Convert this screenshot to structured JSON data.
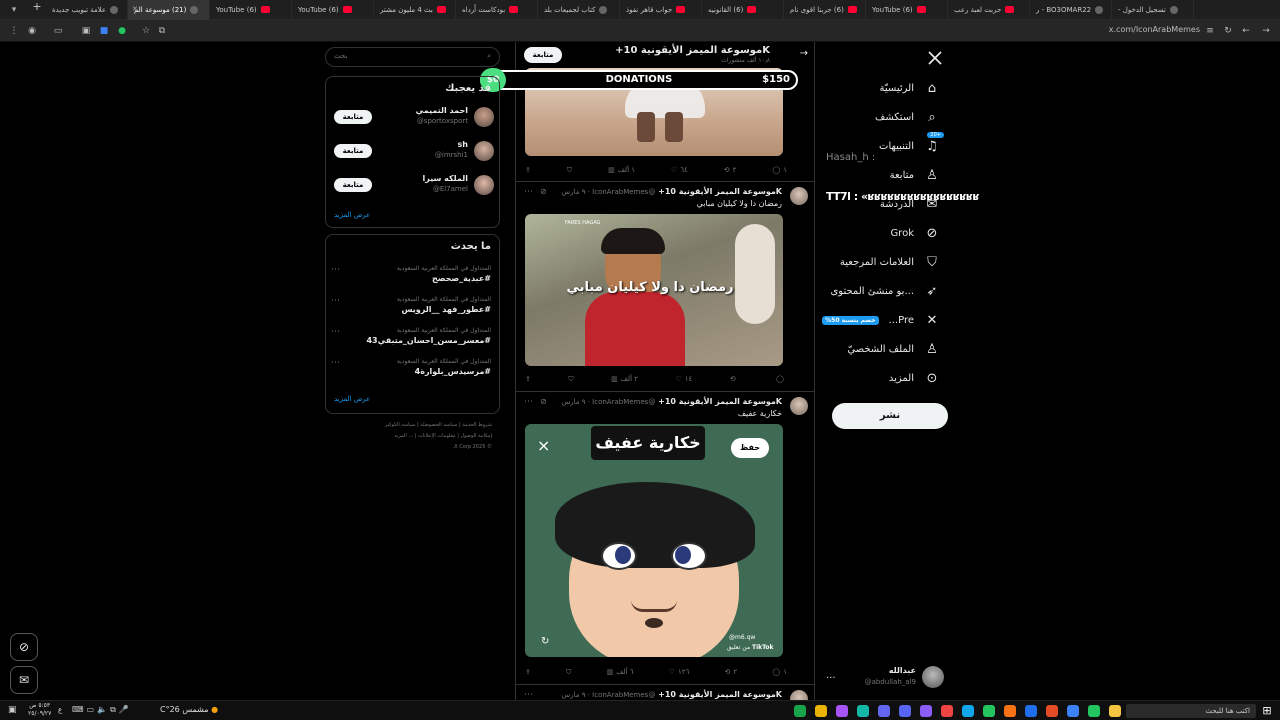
{
  "browser": {
    "tabs": [
      {
        "label": "تسجيل الدخول -",
        "kind": "dot"
      },
      {
        "label": "BO3OMAR22 - ر",
        "kind": "dot"
      },
      {
        "label": "جربت لعبة رعب",
        "kind": "yt"
      },
      {
        "label": "(6) YouTube",
        "kind": "yt"
      },
      {
        "label": "(6) جربنا اقوى نام",
        "kind": "yt"
      },
      {
        "label": "(6) القانونيه",
        "kind": "yt"
      },
      {
        "label": "جواب قاهر نفوذ",
        "kind": "yt"
      },
      {
        "label": "كتاب لجميعات بلد",
        "kind": "dot"
      },
      {
        "label": "بودكاست أَرداه",
        "kind": "yt"
      },
      {
        "label": "بث 4 مليون مشتر",
        "kind": "yt"
      },
      {
        "label": "(6) YouTube",
        "kind": "yt"
      },
      {
        "label": "(6) YouTube",
        "kind": "yt"
      },
      {
        "label": "(21) موسوعة الم",
        "kind": "dot",
        "active": true
      },
      {
        "label": "علامة تبويب جديدة",
        "kind": "dot"
      }
    ],
    "new_tab": "+",
    "url": "x.com/IconArabMemes"
  },
  "nav": {
    "items": [
      {
        "label": "الرئيسيّة",
        "icon": "home-icon"
      },
      {
        "label": "استكشف",
        "icon": "search-icon"
      },
      {
        "label": "التنبيهات",
        "icon": "bell-icon",
        "badge": "+20"
      },
      {
        "label": "متابعة",
        "icon": "people-icon"
      },
      {
        "label": "الدردشة",
        "icon": "chat-icon"
      },
      {
        "label": "Grok",
        "icon": "grok-icon"
      },
      {
        "label": "العلامات المرجعية",
        "icon": "bookmark-icon"
      },
      {
        "label": "...بو منشئ المحتوى",
        "icon": "rocket-icon"
      },
      {
        "label": "Pre...",
        "icon": "x-icon",
        "badge": "خصم بنسبة 50%"
      },
      {
        "label": "الملف الشخصيّ",
        "icon": "profile-icon"
      },
      {
        "label": "المزيد",
        "icon": "more-icon"
      }
    ],
    "post_button": "نشر",
    "account": {
      "name": "عبدالله",
      "handle": "@abdullah_al9",
      "more": "..."
    },
    "overlay": {
      "line1": "Hasah_h :",
      "line2": "ТТ7l : «ʁʁʁʁʁʁʁʁʁʁʁʁʁʁʁʁʁ"
    }
  },
  "header": {
    "name": "Kموسوعة الميمز الأيقونية 10+",
    "subtitle": "١٠٫٨ ألف منشورات",
    "follow": "متابعة",
    "back": "→"
  },
  "donations": {
    "left": "$0",
    "center": "DONATIONS",
    "right": "$150"
  },
  "tweets": [
    {
      "actions": {
        "reply": "١",
        "retweet": "٢",
        "like": "٦٤",
        "views": "١ ألف"
      }
    },
    {
      "name": "Kموسوعة الميمز الأيقونية 10+",
      "handle": "@IconArabMemes · ٩ مارس",
      "text": "رمضان دا ولا كيليان مبابي",
      "caption": "رمضان دا ولا كيليان مبابي",
      "watermark": "FARES HAGAG",
      "actions": {
        "reply": "",
        "retweet": "",
        "like": "١٤",
        "views": "٢ ألف"
      }
    },
    {
      "name": "Kموسوعة الميمز الأيقونية 10+",
      "handle": "@IconArabMemes · ٩ مارس",
      "text": "خكارية عفيف",
      "title": "خكارية عفيف",
      "save": "حفظ",
      "close": "×",
      "tiktok": "TikTok",
      "tiktok_user": "@m6.qw",
      "from": "من تعليق",
      "actions": {
        "reply": "١",
        "retweet": "٢",
        "like": "١٢٦",
        "views": "٦ ألف"
      }
    },
    {
      "name": "Kموسوعة الميمز الأيقونية 10+",
      "handle": "@IconArabMemes · ٩ مارس"
    }
  ],
  "sidebar": {
    "search_placeholder": "بحث",
    "who_to_follow": {
      "title": "قد يعجبك",
      "users": [
        {
          "name": "احمد التميمي",
          "handle": "@sportoxsport",
          "button": "متابعة"
        },
        {
          "name": "sh",
          "handle": "@imrshi1",
          "button": "متابعة"
        },
        {
          "name": "الملكه سيرا",
          "handle": "@El7amel",
          "button": "متابعة"
        }
      ],
      "more": "عرض المزيد"
    },
    "trends": {
      "title": "ما يحدث",
      "items": [
        {
          "meta": "المتداول في المملكة العربية السعودية",
          "tag": "#عبدية_صحصح"
        },
        {
          "meta": "المتداول في المملكة العربية السعودية",
          "tag": "#عطور_فهد __الرويس"
        },
        {
          "meta": "المتداول في المملكة العربية السعودية",
          "tag": "#معسر_مسن_احسان_متبقي43"
        },
        {
          "meta": "المتداول في المملكة العربية السعودية",
          "tag": "#مرسيدس_بلوارة4"
        }
      ],
      "more": "عرض المزيد"
    },
    "footer": {
      "line1": "شروط الخدمة | سياسة الخصوصيّة | سياسة الكوكيز",
      "line2": "إمكانية الوصول | معلومات الإعلانات | ... المزيد",
      "line3": "© 2025 X Corp."
    }
  },
  "taskbar": {
    "weather": "مشمس 26°C",
    "search": "اكتب هنا للبحث",
    "time": "٥:٥٣ ص",
    "date": "٢٥/٠٩/٢٧",
    "lang": "ع"
  },
  "colors": {
    "accent": "#1d9bf0",
    "background": "#000000",
    "border": "#2f3336",
    "donate_green": "#4ade80"
  }
}
